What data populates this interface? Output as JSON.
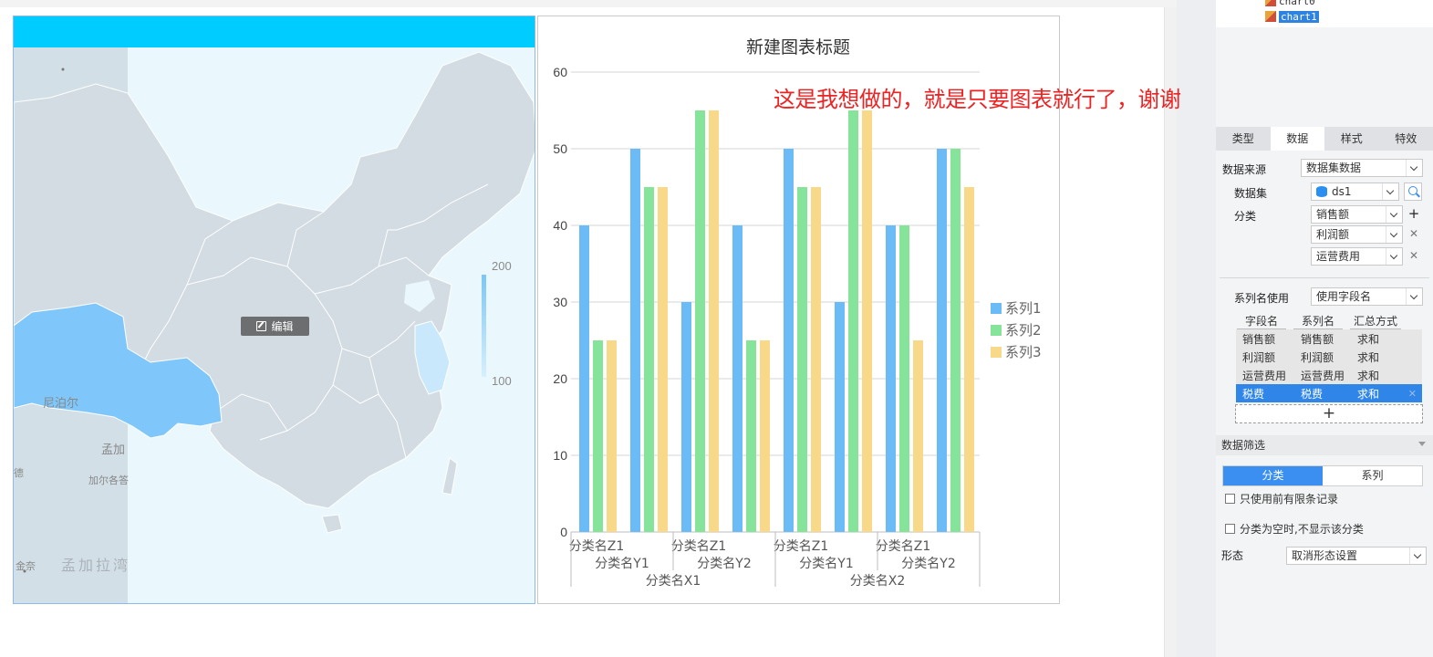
{
  "tree": {
    "items": [
      "chart0",
      "chart1"
    ],
    "selected": "chart1"
  },
  "map": {
    "edit_label": "编辑",
    "legend_max": "200",
    "legend_min": "100",
    "labels": {
      "nepal": "尼泊尔",
      "bangladesh": "孟加拉湾",
      "meng": "孟加",
      "jiaerge": "加尔各答",
      "jinnai": "金奈",
      "di": "德"
    },
    "colors": {
      "header": "#00ccff",
      "land": "#d3dce3",
      "highlight": "#7fc7fa",
      "highlight_light": "#c9e8fb",
      "water": "#eaf7fd"
    }
  },
  "annotation": "这是我想做的，就是只要图表就行了，谢谢",
  "chart_data": {
    "type": "bar",
    "title": "新建图表标题",
    "ylim": [
      0,
      60
    ],
    "yticks": [
      0,
      10,
      20,
      30,
      40,
      50,
      60
    ],
    "categories": [
      "分类名Z1",
      "分类名Z1",
      "分类名Z1",
      "分类名Z1",
      "分类名Z1",
      "分类名Z1",
      "分类名Z1",
      "分类名Z1"
    ],
    "level2": [
      "分类名Y1",
      "分类名Y2",
      "分类名Y1",
      "分类名Y2"
    ],
    "level3": [
      "分类名X1",
      "分类名X2"
    ],
    "series": [
      {
        "name": "系列1",
        "color": "#6bbcf6",
        "values": [
          40,
          50,
          30,
          40,
          50,
          30,
          40,
          50
        ]
      },
      {
        "name": "系列2",
        "color": "#86e49a",
        "values": [
          25,
          45,
          55,
          25,
          45,
          55,
          40,
          50
        ]
      },
      {
        "name": "系列3",
        "color": "#f8d98a",
        "values": [
          25,
          45,
          55,
          25,
          45,
          55,
          25,
          45
        ]
      }
    ],
    "legend": "right",
    "grid": true
  },
  "panel": {
    "tabs": [
      "类型",
      "数据",
      "样式",
      "特效"
    ],
    "active_tab": "数据",
    "data_source_label": "数据来源",
    "data_source_value": "数据集数据",
    "dataset_label": "数据集",
    "dataset_value": "ds1",
    "category_label": "分类",
    "category_fields": [
      "销售额",
      "利润额",
      "运营费用"
    ],
    "series_name_label": "系列名使用",
    "series_name_value": "使用字段名",
    "grid_headers": [
      "字段名",
      "系列名",
      "汇总方式"
    ],
    "grid_rows": [
      [
        "销售额",
        "销售额",
        "求和"
      ],
      [
        "利润额",
        "利润额",
        "求和"
      ],
      [
        "运营费用",
        "运营费用",
        "求和"
      ],
      [
        "税费",
        "税费",
        "求和"
      ]
    ],
    "filter_section": "数据筛选",
    "filter_tabs": [
      "分类",
      "系列"
    ],
    "check_top_n": "只使用前有限条记录",
    "check_hide_empty": "分类为空时,不显示该分类",
    "form_label": "形态",
    "form_value": "取消形态设置"
  }
}
